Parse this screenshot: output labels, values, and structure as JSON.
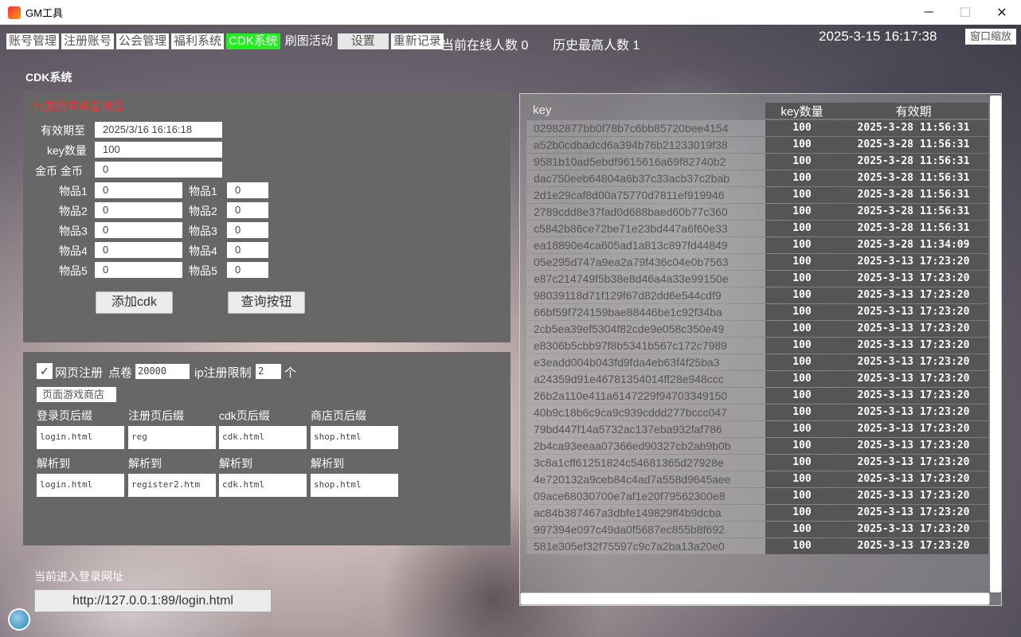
{
  "window": {
    "title": "GM工具",
    "min": "─",
    "max": "☐",
    "close": "✕"
  },
  "menu": {
    "items": [
      "账号管理",
      "注册账号",
      "公会管理",
      "福利系统",
      "CDK系统",
      "刷图活动",
      "设置",
      "重新记录"
    ],
    "active_index": 4
  },
  "stats": {
    "online": "当前在线人数 0",
    "history": "历史最高人数 1"
  },
  "datetime": "2025-3-15 16:17:38",
  "zoom_label": "窗口缩放",
  "cdk": {
    "section_title": "CDK系统",
    "warning": "只支持非点卷物品",
    "expire_label": "有效期至",
    "expire_value": "2025/3/16 16:16:18",
    "keycount_label": "key数量",
    "keycount_value": "100",
    "gold_label": "金币 金币",
    "gold_value": "0",
    "items": [
      {
        "label": "物品1",
        "value": "0",
        "count_label": "物品1",
        "count": "0"
      },
      {
        "label": "物品2",
        "value": "0",
        "count_label": "物品2",
        "count": "0"
      },
      {
        "label": "物品3",
        "value": "0",
        "count_label": "物品3",
        "count": "0"
      },
      {
        "label": "物品4",
        "value": "0",
        "count_label": "物品4",
        "count": "0"
      },
      {
        "label": "物品5",
        "value": "0",
        "count_label": "物品5",
        "count": "0"
      }
    ],
    "add_button": "添加cdk",
    "query_button": "查询按钮"
  },
  "web": {
    "checkbox_checked": "✓",
    "register_label": "网页注册",
    "points_label": "点卷",
    "points_value": "20000",
    "ip_label": "ip注册限制",
    "ip_value": "2",
    "ip_unit": "个",
    "shop_button": "页面游戏商店",
    "suffix_labels": [
      "登录页后缀",
      "注册页后缀",
      "cdk页后缀",
      "商店页后缀"
    ],
    "suffix_values": [
      "login.html",
      "reg",
      "cdk.html",
      "shop.html"
    ],
    "resolve_labels": [
      "解析到",
      "解析到",
      "解析到",
      "解析到"
    ],
    "resolve_values": [
      "login.html",
      "register2.htm",
      "cdk.html",
      "shop.html"
    ]
  },
  "login": {
    "label": "当前进入登录网址",
    "url": "http://127.0.0.1:89/login.html"
  },
  "table": {
    "headers": {
      "key": "key",
      "count": "key数量",
      "expire": "有效期"
    },
    "rows": [
      [
        "02982877bb0f78b7c6bb85720bee4154",
        "100",
        "2025-3-28 11:56:31"
      ],
      [
        "a52b0cdbadcd6a394b76b21233019f38",
        "100",
        "2025-3-28 11:56:31"
      ],
      [
        "9581b10ad5ebdf9615616a69f82740b2",
        "100",
        "2025-3-28 11:56:31"
      ],
      [
        "dac750eeb64804a6b37c33acb37c2bab",
        "100",
        "2025-3-28 11:56:31"
      ],
      [
        "2d1e29caf8d00a75770d7811ef919946",
        "100",
        "2025-3-28 11:56:31"
      ],
      [
        "2789cdd8e37fad0d688baed60b77c360",
        "100",
        "2025-3-28 11:56:31"
      ],
      [
        "c5842b86ce72be71e23bd447a6f60e33",
        "100",
        "2025-3-28 11:56:31"
      ],
      [
        "ea18890e4ca605ad1a813c897fd44849",
        "100",
        "2025-3-28 11:34:09"
      ],
      [
        "05e295d747a9ea2a79f436c04e0b7563",
        "100",
        "2025-3-13 17:23:20"
      ],
      [
        "e87c214749f5b38e8d46a4a33e99150e",
        "100",
        "2025-3-13 17:23:20"
      ],
      [
        "98039118d71f129f67d82dd6e544cdf9",
        "100",
        "2025-3-13 17:23:20"
      ],
      [
        "66bf59f724159bae88446be1c92f34ba",
        "100",
        "2025-3-13 17:23:20"
      ],
      [
        "2cb5ea39ef5304f82cde9e058c350e49",
        "100",
        "2025-3-13 17:23:20"
      ],
      [
        "e8306b5cbb97f8b5341b567c172c7989",
        "100",
        "2025-3-13 17:23:20"
      ],
      [
        "e3eadd004b043fd9fda4eb63f4f25ba3",
        "100",
        "2025-3-13 17:23:20"
      ],
      [
        "a24359d91e46781354014ff28e948ccc",
        "100",
        "2025-3-13 17:23:20"
      ],
      [
        "26b2a110e411a6147229f94703349150",
        "100",
        "2025-3-13 17:23:20"
      ],
      [
        "40b9c18b6c9ca9c939cddd277bccc047",
        "100",
        "2025-3-13 17:23:20"
      ],
      [
        "79bd447f14a5732ac137eba932faf786",
        "100",
        "2025-3-13 17:23:20"
      ],
      [
        "2b4ca93eeaa07366ed90327cb2ab9b0b",
        "100",
        "2025-3-13 17:23:20"
      ],
      [
        "3c8a1cff61251824c54681365d27928e",
        "100",
        "2025-3-13 17:23:20"
      ],
      [
        "4e720132a9ceb84c4ad7a558d9645aee",
        "100",
        "2025-3-13 17:23:20"
      ],
      [
        "09ace68030700e7af1e20f79562300e8",
        "100",
        "2025-3-13 17:23:20"
      ],
      [
        "ac84b387467a3dbfe149829ff4b9dcba",
        "100",
        "2025-3-13 17:23:20"
      ],
      [
        "997394e097c49da0f5687ec855b8f692",
        "100",
        "2025-3-13 17:23:20"
      ],
      [
        "581e305ef32f75597c9c7a2ba13a20e0",
        "100",
        "2025-3-13 17:23:20"
      ]
    ]
  }
}
